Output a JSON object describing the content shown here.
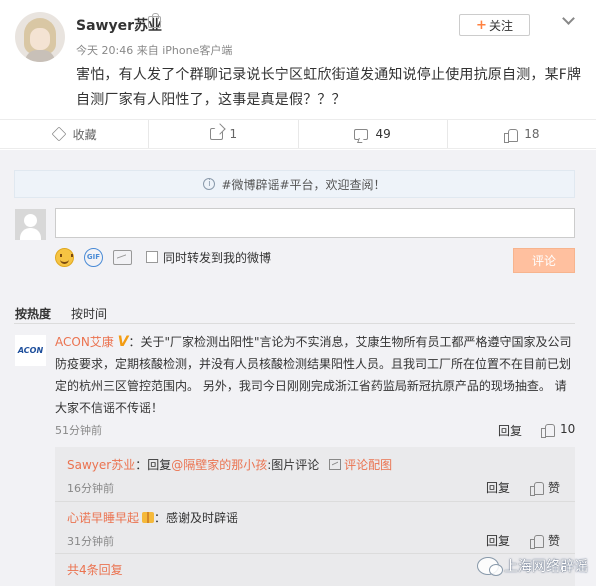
{
  "post": {
    "username": "Sawyer苏业",
    "meta": "今天 20:46 来自 iPhone客户端",
    "follow_label": "关注",
    "text_line1": "害怕，有人发了个群聊记录说长宁区虹欣街道发通知说停止使用抗原自测，某F牌",
    "text_line2": "自测厂家有人阳性了，这事是真是假？？？"
  },
  "actions": {
    "favorite_label": "收藏",
    "repost_count": "1",
    "comment_count": "49",
    "like_count": "18"
  },
  "notice": {
    "text": "#微博辟谣#平台，欢迎查阅！"
  },
  "compose": {
    "repost_also_label": "同时转发到我的微博",
    "submit_label": "评论",
    "gif_icon_text": "GIF"
  },
  "sort": {
    "hot": "按热度",
    "time": "按时间"
  },
  "comment": {
    "avatar_text": "ACON",
    "user": "ACON艾康",
    "v_badge": "V",
    "line1": "：关于\"厂家检测出阳性\"言论为不实消息，艾康生物所有员工都严格遵守国家及公司",
    "line2": "防疫要求，定期核酸检测，并没有人员核酸检测结果阳性人员。且我司工厂所在位置不在目前已划",
    "line3": "定的杭州三区管控范围内。 另外，我司今日刚刚完成浙江省药监局新冠抗原产品的现场抽查。 请",
    "line4": "大家不信谣不传谣！",
    "time": "51分钟前",
    "reply_label": "回复",
    "like_count": "10"
  },
  "replies": [
    {
      "user": "Sawyer苏业",
      "prefix": "：回复",
      "mention": "@隔壁家的那小孩",
      "text": ":图片评论",
      "link": "评论配图",
      "time": "16分钟前",
      "reply_label": "回复",
      "like_label": "赞"
    },
    {
      "user": "心诺早睡早起",
      "text": "：感谢及时辟谣",
      "time": "31分钟前",
      "reply_label": "回复",
      "like_label": "赞"
    }
  ],
  "total_replies": "共4条回复",
  "watermark": "上海网络辟谣"
}
